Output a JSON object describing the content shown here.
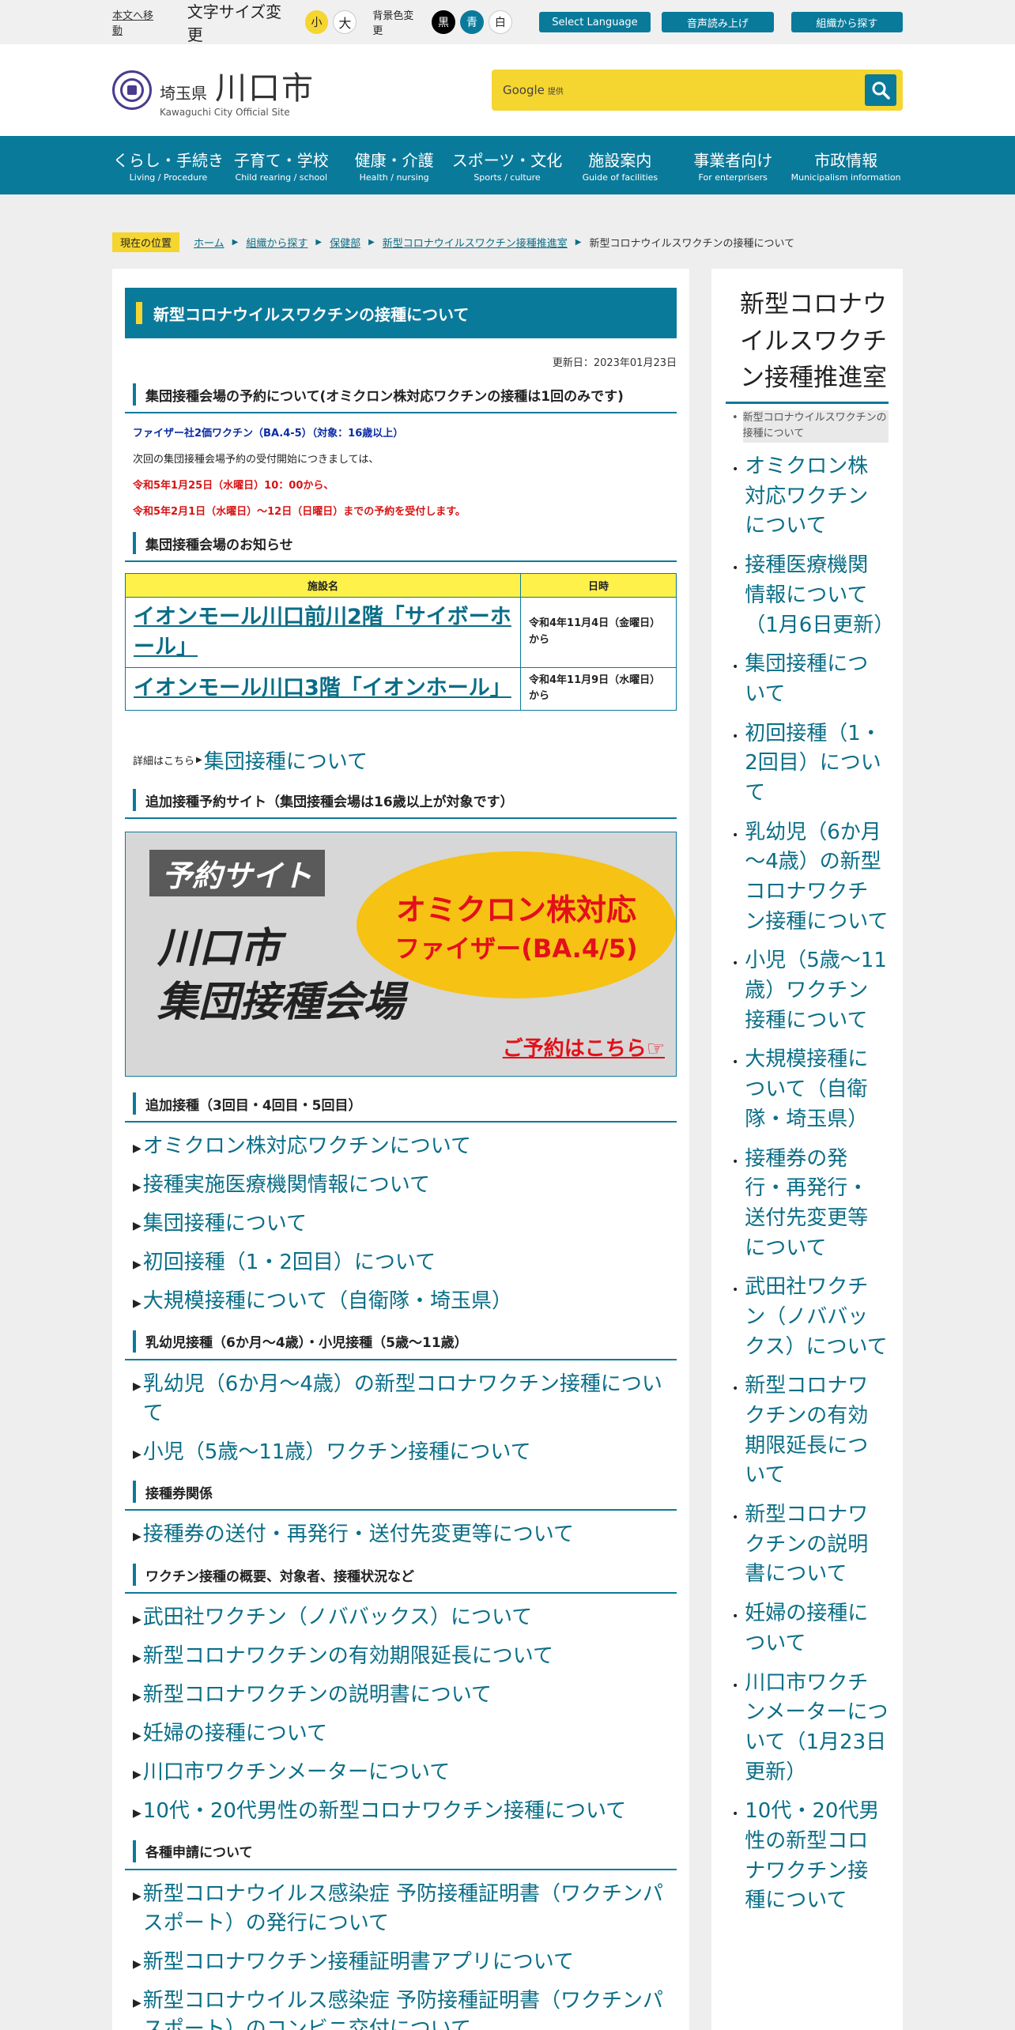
{
  "utility": {
    "skip": "本文へ移動",
    "font_size_label": "文字サイズ変更",
    "font_small": "小",
    "font_large": "大",
    "bg_label": "背景色変更",
    "bg_black": "黒",
    "bg_blue": "青",
    "bg_white": "白",
    "select_language": "Select Language",
    "speech": "音声読み上げ",
    "org_search": "組織から探す"
  },
  "header": {
    "pref": "埼玉県",
    "city": "川口市",
    "sub": "Kawaguchi City Official Site",
    "search_brand": "Google",
    "search_provided": "提供"
  },
  "nav": [
    {
      "jp": "くらし・手続き",
      "en": "Living / Procedure"
    },
    {
      "jp": "子育て・学校",
      "en": "Child rearing / school"
    },
    {
      "jp": "健康・介護",
      "en": "Health / nursing"
    },
    {
      "jp": "スポーツ・文化",
      "en": "Sports / culture"
    },
    {
      "jp": "施設案内",
      "en": "Guide of facilities"
    },
    {
      "jp": "事業者向け",
      "en": "For enterprisers"
    },
    {
      "jp": "市政情報",
      "en": "Municipalism information"
    }
  ],
  "breadcrumb": {
    "label": "現在の位置",
    "items": [
      "ホーム",
      "組織から探す",
      "保健部",
      "新型コロナウイルスワクチン接種推進室"
    ],
    "current": "新型コロナウイルスワクチンの接種について"
  },
  "main": {
    "title": "新型コロナウイルスワクチンの接種について",
    "updated": "更新日：2023年01月23日",
    "sections": {
      "reservation": "集団接種会場の予約について(オミクロン株対応ワクチンの接種は1回のみです)",
      "notice": "集団接種会場のお知らせ",
      "booster_site": "追加接種予約サイト（集団接種会場は16歳以上が対象です）",
      "booster": "追加接種（3回目・4回目・5回目）",
      "children": "乳幼児接種（6か月～4歳）・小児接種（5歳～11歳）",
      "tickets": "接種券関係",
      "overview": "ワクチン接種の概要、対象者、接種状況など",
      "certificates": "各種申請について"
    },
    "vaccine_line": "ファイザー社2価ワクチン（BA.4-5）（対象：16歳以上）",
    "next_line": "次回の集団接種会場予約の受付開始につきましては、",
    "red_line1": "令和5年1月25日（水曜日）10：00から、",
    "red_line2": "令和5年2月1日（水曜日）～12日（日曜日）までの予約を受付します。",
    "table": {
      "col_name": "施設名",
      "col_date": "日時",
      "rows": [
        {
          "name": "イオンモール川口前川2階「サイボーホール」",
          "date": "令和4年11月4日（金曜日）から"
        },
        {
          "name": "イオンモール川口3階「イオンホール」",
          "date": "令和4年11月9日（水曜日）から"
        }
      ]
    },
    "detail_prefix": "詳細はこちら",
    "detail_link": "集団接種について",
    "banner": {
      "tag": "予約サイト",
      "ellipse_l1": "オミクロン株対応",
      "ellipse_l2": "ファイザー(BA.4/5)",
      "city_l1": "川口市",
      "city_l2": "集団接種会場",
      "cta": "ご予約はこちら☞"
    },
    "booster_links": [
      "オミクロン株対応ワクチンについて",
      "接種実施医療機関情報について",
      "集団接種について",
      "初回接種（1・2回目）について",
      "大規模接種について（自衛隊・埼玉県）"
    ],
    "children_links": [
      "乳幼児（6か月～4歳）の新型コロナワクチン接種について",
      "小児（5歳～11歳）ワクチン接種について"
    ],
    "ticket_links": [
      "接種券の送付・再発行・送付先変更等について"
    ],
    "overview_links": [
      "武田社ワクチン（ノババックス）について",
      "新型コロナワクチンの有効期限延長について",
      "新型コロナワクチンの説明書について",
      "妊婦の接種について",
      "川口市ワクチンメーターについて",
      "10代・20代男性の新型コロナワクチン接種について"
    ],
    "certificate_links": [
      "新型コロナウイルス感染症 予防接種証明書（ワクチンパスポート）の発行について",
      "新型コロナワクチン接種証明書アプリについて",
      "新型コロナウイルス感染症 予防接種証明書（ワクチンパスポート）のコンビニ交付について"
    ]
  },
  "sidebar": {
    "title": "新型コロナウイルスワクチン接種推進室",
    "current": "新型コロナウイルスワクチンの接種について",
    "items": [
      "オミクロン株対応ワクチンについて",
      "接種医療機関情報について（1月6日更新）",
      "集団接種について",
      "初回接種（1・2回目）について",
      "乳幼児（6か月～4歳）の新型コロナワクチン接種について",
      "小児（5歳～11歳）ワクチン接種について",
      "大規模接種について（自衛隊・埼玉県）",
      "接種券の発行・再発行・送付先変更等について",
      "武田社ワクチン（ノババックス）について",
      "新型コロナワクチンの有効期限延長について",
      "新型コロナワクチンの説明書について",
      "妊婦の接種について",
      "川口市ワクチンメーターについて（1月23日更新）",
      "10代・20代男性の新型コロナワクチン接種について"
    ]
  },
  "colors": {
    "brand_blue": "#0a7a9b",
    "accent_yellow": "#f5d52f",
    "alert_red": "#d61414"
  }
}
